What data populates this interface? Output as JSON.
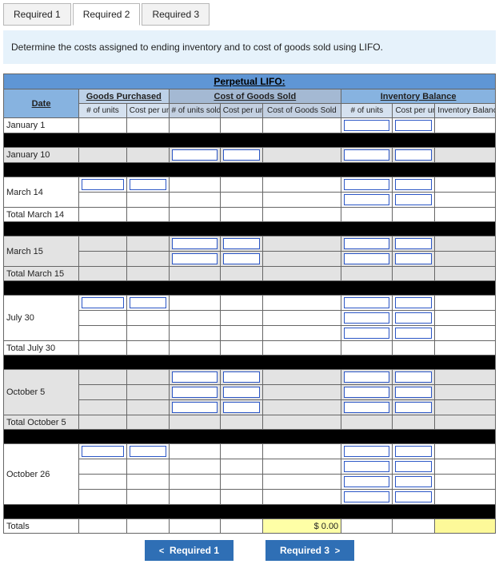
{
  "tabs": {
    "t1": "Required 1",
    "t2": "Required 2",
    "t3": "Required 3",
    "active": "t2"
  },
  "instruction": "Determine the costs assigned to ending inventory and to cost of goods sold using LIFO.",
  "table": {
    "title": "Perpetual LIFO:",
    "date_header": "Date",
    "groups": {
      "gp": "Goods Purchased",
      "cogs": "Cost of Goods Sold",
      "inv": "Inventory Balance"
    },
    "cols": {
      "gp_units": "# of units",
      "gp_cost": "Cost per unit",
      "cogs_units": "# of units sold",
      "cogs_cost": "Cost per unit",
      "cogs_total": "Cost of Goods Sold",
      "inv_units": "# of units",
      "inv_cost": "Cost per unit",
      "inv_total": "Inventory Balance"
    },
    "rows": {
      "jan1": "January 1",
      "jan10": "January 10",
      "mar14": "March 14",
      "tmar14": "Total March 14",
      "mar15": "March 15",
      "tmar15": "Total March 15",
      "jul30": "July 30",
      "tjul30": "Total July 30",
      "oct5": "October 5",
      "toct5": "Total October 5",
      "oct26": "October 26",
      "totals": "Totals"
    },
    "totals": {
      "cogs_total": "$        0.00",
      "inv_total": ""
    }
  },
  "nav": {
    "prev": "Required 1",
    "next": "Required 3",
    "prev_chev": "<",
    "next_chev": ">"
  }
}
